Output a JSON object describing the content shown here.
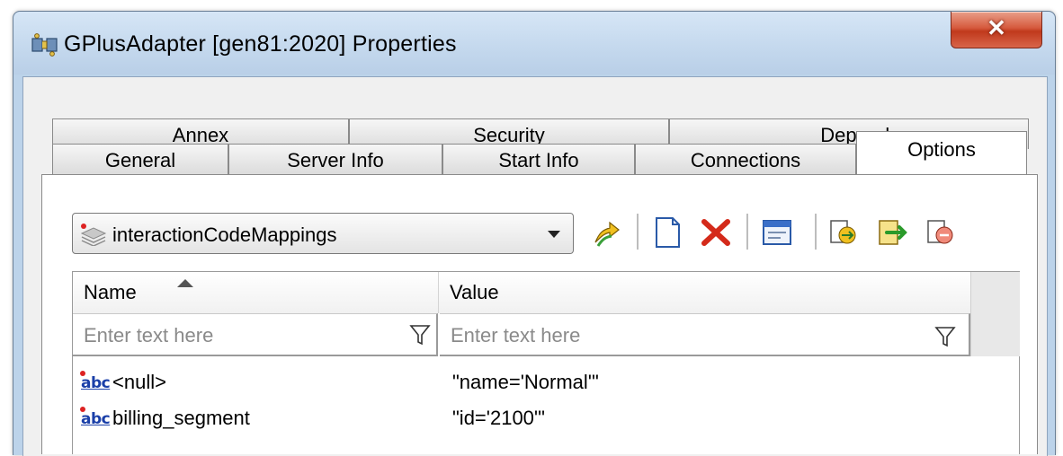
{
  "window": {
    "title": "GPlusAdapter [gen81:2020] Properties",
    "close_label": "✕"
  },
  "tabs": {
    "row_back": [
      {
        "label": "Annex"
      },
      {
        "label": "Security"
      },
      {
        "label": "Dependency"
      }
    ],
    "row_front": [
      {
        "label": "General"
      },
      {
        "label": "Server Info"
      },
      {
        "label": "Start Info"
      },
      {
        "label": "Connections"
      },
      {
        "label": "Options",
        "active": true
      }
    ]
  },
  "options": {
    "section_dropdown": {
      "selected": "interactionCodeMappings"
    },
    "toolbar": [
      "move-up-icon",
      "new-icon",
      "delete-icon",
      "edit-icon",
      "import-icon",
      "export-icon",
      "copy-icon"
    ]
  },
  "grid": {
    "columns": [
      {
        "label": "Name",
        "sorted": "ascending"
      },
      {
        "label": "Value"
      }
    ],
    "filter_placeholder": "Enter text here",
    "rows": [
      {
        "icon": "abc",
        "name": "<null>",
        "value": "\"name='Normal'\""
      },
      {
        "icon": "abc",
        "name": "billing_segment",
        "value": "\"id='2100'\""
      }
    ]
  },
  "colors": {
    "close_button": "#c0391c",
    "delete_icon": "#d42a1a",
    "titlebar": "#c5d9ee"
  }
}
